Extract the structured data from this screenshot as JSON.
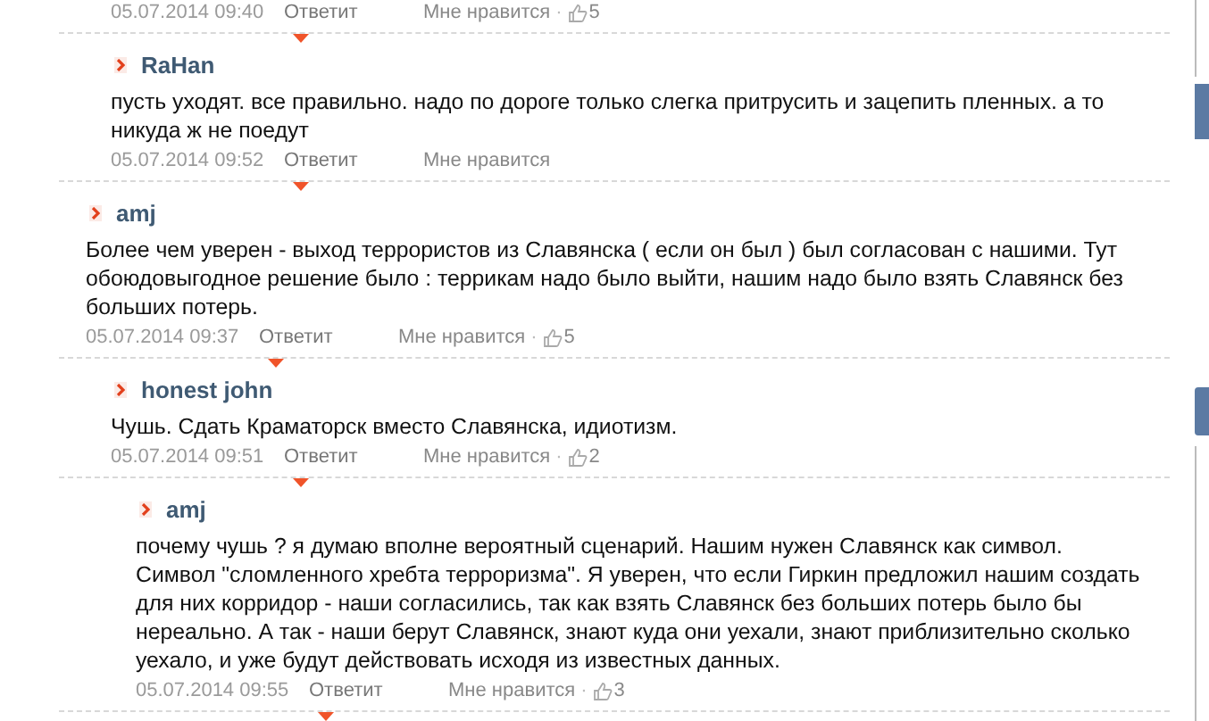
{
  "comments": [
    {
      "children": [
        {
          "footer": {
            "date": "05.07.2014 09:40",
            "reply": "Ответит",
            "like": "Мне нравится",
            "separator": "·",
            "likes": "5"
          }
        },
        {
          "author": "RaHan",
          "text": "пусть уходят. все правильно. надо по дороге только слегка притрусить и зацепить пленных. а то никуда ж не поедут",
          "footer": {
            "date": "05.07.2014 09:52",
            "reply": "Ответит",
            "like": "Мне нравится"
          }
        }
      ]
    },
    {
      "author": "amj",
      "text": "Более чем уверен - выход террористов из Славянска ( если он был ) был согласован с нашими. Тут обоюдовыгодное решение было : террикам надо было выйти, нашим надо было взять Славянск без больших потерь.",
      "footer": {
        "date": "05.07.2014 09:37",
        "reply": "Ответит",
        "like": "Мне нравится",
        "separator": "·",
        "likes": "5"
      },
      "children": [
        {
          "author": "honest john",
          "text": "Чушь. Сдать Краматорск вместо Славянска, идиотизм.",
          "footer": {
            "date": "05.07.2014 09:51",
            "reply": "Ответит",
            "like": "Мне нравится",
            "separator": "·",
            "likes": "2"
          },
          "children": [
            {
              "author": "amj",
              "text": "почему чушь ? я думаю вполне вероятный сценарий. Нашим нужен Славянск как символ. Символ \"сломленного хребта терроризма\". Я уверен, что если Гиркин предложил нашим создать для них корридор - наши согласились, так как взять Славянск без больших потерь было бы нереально. А так - наши берут Славянск, знают куда они уехали, знают приблизительно сколько уехало, и уже будут действовать исходя из известных данных.",
              "footer": {
                "date": "05.07.2014 09:55",
                "reply": "Ответит",
                "like": "Мне нравится",
                "separator": "·",
                "likes": "3"
              }
            }
          ]
        }
      ]
    }
  ]
}
